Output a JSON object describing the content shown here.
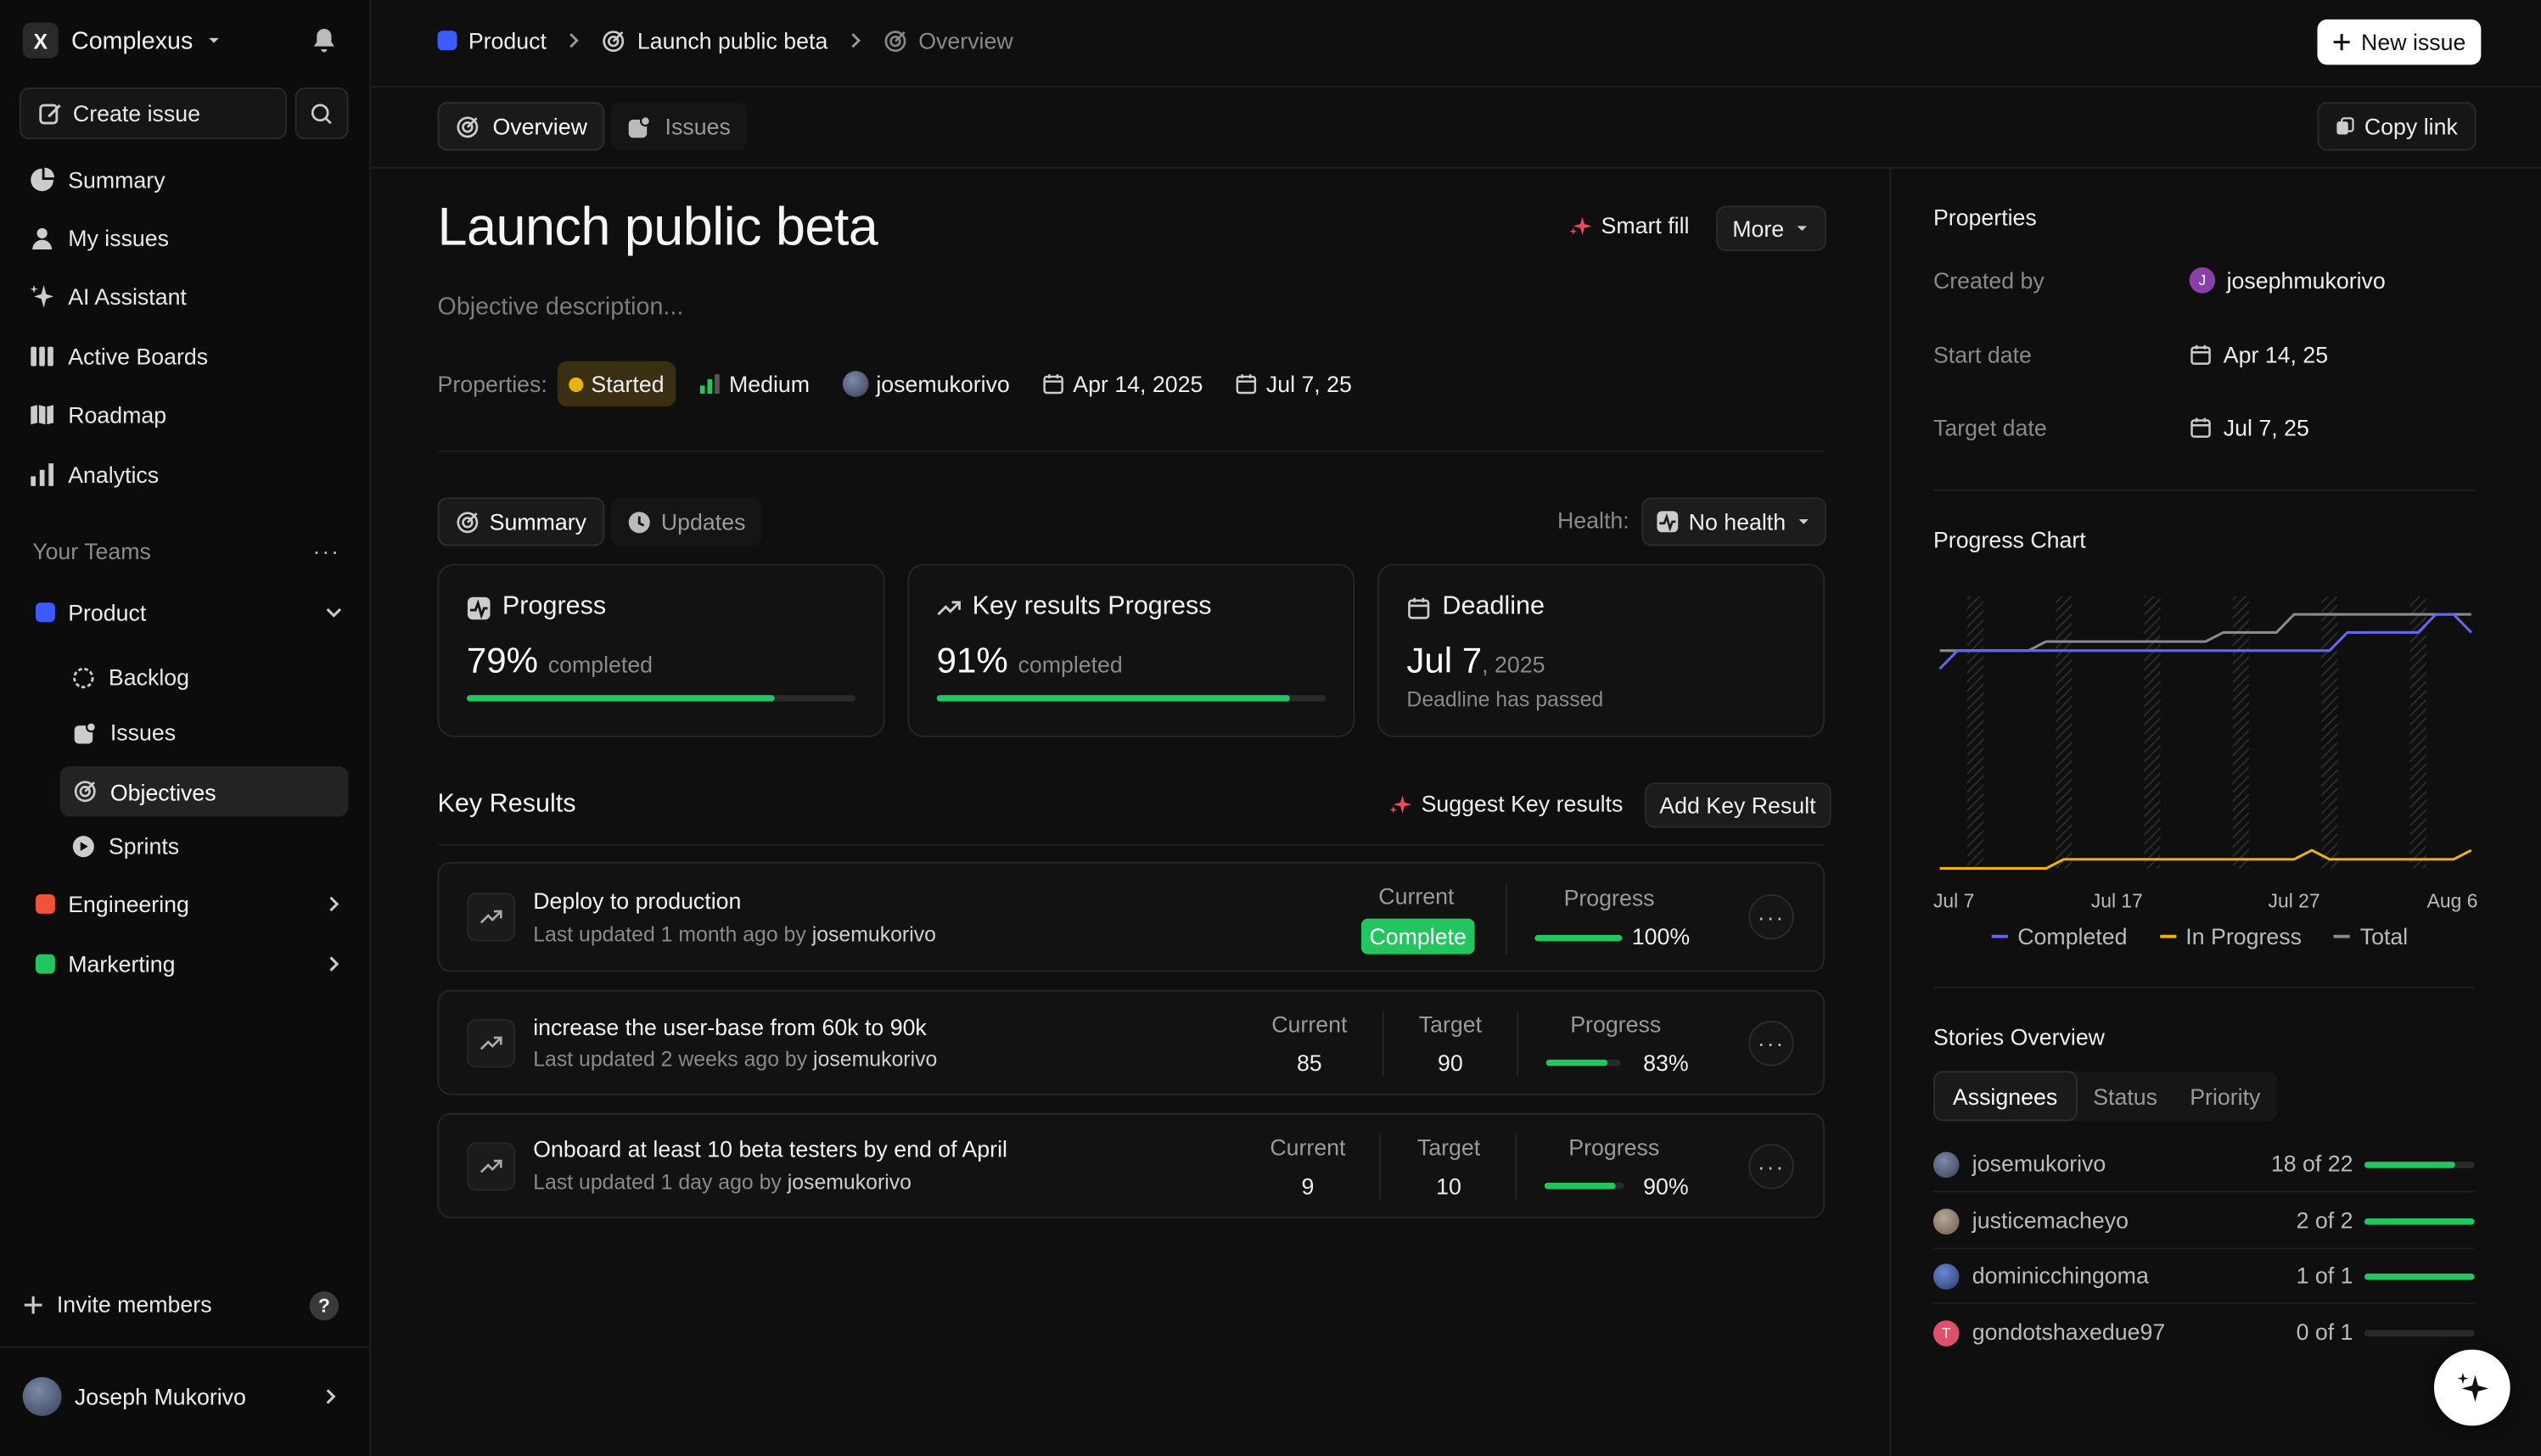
{
  "workspace": {
    "name": "Complexus",
    "logo_glyph": "X"
  },
  "sidebar": {
    "create_issue": "Create issue",
    "nav": [
      {
        "label": "Summary",
        "icon": "pie-chart-icon"
      },
      {
        "label": "My issues",
        "icon": "user-icon"
      },
      {
        "label": "AI Assistant",
        "icon": "sparkle-icon"
      },
      {
        "label": "Active Boards",
        "icon": "board-icon"
      },
      {
        "label": "Roadmap",
        "icon": "map-icon"
      },
      {
        "label": "Analytics",
        "icon": "bar-chart-icon"
      }
    ],
    "teams_heading": "Your Teams",
    "teams": [
      {
        "name": "Product",
        "color": "#3b5bfd"
      },
      {
        "name": "Engineering",
        "color": "#f0533a"
      },
      {
        "name": "Markerting",
        "color": "#22c55e"
      }
    ],
    "product_items": [
      {
        "label": "Backlog",
        "icon": "backlog-icon"
      },
      {
        "label": "Issues",
        "icon": "issues-icon"
      },
      {
        "label": "Objectives",
        "icon": "objective-icon"
      },
      {
        "label": "Sprints",
        "icon": "sprint-icon"
      }
    ],
    "invite": "Invite members",
    "help": "?",
    "user": "Joseph Mukorivo"
  },
  "header": {
    "breadcrumb": [
      "Product",
      "Launch public beta",
      "Overview"
    ],
    "new_issue": "New issue",
    "tabs": [
      "Overview",
      "Issues"
    ],
    "copy_link": "Copy link"
  },
  "objective": {
    "title": "Launch public beta",
    "description_placeholder": "Objective description...",
    "smart_fill": "Smart fill",
    "more": "More",
    "properties_label": "Properties:",
    "status": "Started",
    "priority": "Medium",
    "owner": "josemukorivo",
    "start": "Apr 14, 2025",
    "target": "Jul 7, 25"
  },
  "summary": {
    "tabs": [
      "Summary",
      "Updates"
    ],
    "health_label": "Health:",
    "health_value": "No health",
    "cards": {
      "progress": {
        "title": "Progress",
        "value": "79%",
        "suffix": "completed",
        "pct": 0.79
      },
      "kr_progress": {
        "title": "Key results Progress",
        "value": "91%",
        "suffix": "completed",
        "pct": 0.91
      },
      "deadline": {
        "title": "Deadline",
        "date": "Jul 7",
        "year": ", 2025",
        "note": "Deadline has passed"
      }
    }
  },
  "key_results": {
    "heading": "Key Results",
    "suggest": "Suggest Key results",
    "add": "Add Key Result",
    "col_current": "Current",
    "col_target": "Target",
    "col_progress": "Progress",
    "items": [
      {
        "title": "Deploy to production",
        "updated": "Last updated 1 month ago by",
        "by": "josemukorivo",
        "current": "Complete",
        "progress": "100%",
        "pct": 1.0
      },
      {
        "title": "increase the user-base from 60k to 90k",
        "updated": "Last updated 2 weeks ago by",
        "by": "josemukorivo",
        "current": "85",
        "target": "90",
        "progress": "83%",
        "pct": 0.83
      },
      {
        "title": "Onboard at least 10 beta testers by end of April",
        "updated": "Last updated 1 day ago by",
        "by": "josemukorivo",
        "current": "9",
        "target": "10",
        "progress": "90%",
        "pct": 0.9
      }
    ]
  },
  "properties_panel": {
    "heading": "Properties",
    "created_by_label": "Created by",
    "created_by": "josephmukorivo",
    "created_by_initial": "J",
    "start_label": "Start date",
    "start": "Apr 14, 25",
    "target_label": "Target date",
    "target": "Jul 7, 25"
  },
  "chart_data": {
    "type": "line",
    "title": "Progress Chart",
    "x_ticks": [
      "Jul 7",
      "Jul 17",
      "Jul 27",
      "Aug 6"
    ],
    "x": [
      0,
      1,
      2,
      3,
      4,
      5,
      6,
      7,
      8,
      9,
      10,
      11,
      12,
      13,
      14,
      15,
      16,
      17,
      18,
      19,
      20,
      21,
      22,
      23,
      24,
      25,
      26,
      27,
      28,
      29,
      30
    ],
    "series": [
      {
        "name": "Completed",
        "color": "#6366f1",
        "values": [
          22,
          24,
          24,
          24,
          24,
          24,
          24,
          24,
          24,
          24,
          24,
          24,
          24,
          24,
          24,
          24,
          24,
          24,
          24,
          24,
          24,
          24,
          24,
          26,
          26,
          26,
          26,
          26,
          28,
          28,
          26
        ]
      },
      {
        "name": "In Progress",
        "color": "#eab308",
        "values": [
          0,
          0,
          0,
          0,
          0,
          0,
          0,
          1,
          1,
          1,
          1,
          1,
          1,
          1,
          1,
          1,
          1,
          1,
          1,
          1,
          1,
          2,
          1,
          1,
          1,
          1,
          1,
          1,
          1,
          1,
          2
        ]
      },
      {
        "name": "Total",
        "color": "#8a8a8a",
        "values": [
          24,
          24,
          24,
          24,
          24,
          24,
          25,
          25,
          25,
          25,
          25,
          25,
          25,
          25,
          25,
          25,
          26,
          26,
          26,
          26,
          28,
          28,
          28,
          28,
          28,
          28,
          28,
          28,
          28,
          28,
          28
        ]
      }
    ],
    "hatch_days": [
      2,
      7,
      12,
      17,
      22,
      27
    ]
  },
  "stories": {
    "heading": "Stories Overview",
    "tabs": [
      "Assignees",
      "Status",
      "Priority"
    ],
    "rows": [
      {
        "name": "josemukorivo",
        "count": "18 of 22",
        "pct": 0.82,
        "avatar": "#5b6b8c"
      },
      {
        "name": "justicemacheyo",
        "count": "2 of 2",
        "pct": 1.0,
        "avatar": "#8c7b6b"
      },
      {
        "name": "dominicchingoma",
        "count": "1 of 1",
        "pct": 1.0,
        "avatar": "#4a6bb0"
      },
      {
        "name": "gondotshaxedue97",
        "count": "0 of 1",
        "pct": 0.0,
        "avatar": "#e0506a",
        "initial": "T"
      }
    ]
  },
  "colors": {
    "accent_green": "#22c55e",
    "status_yellow": "#eab308",
    "sparkle_red": "#f0475a",
    "complete_badge": "#22c55e"
  }
}
